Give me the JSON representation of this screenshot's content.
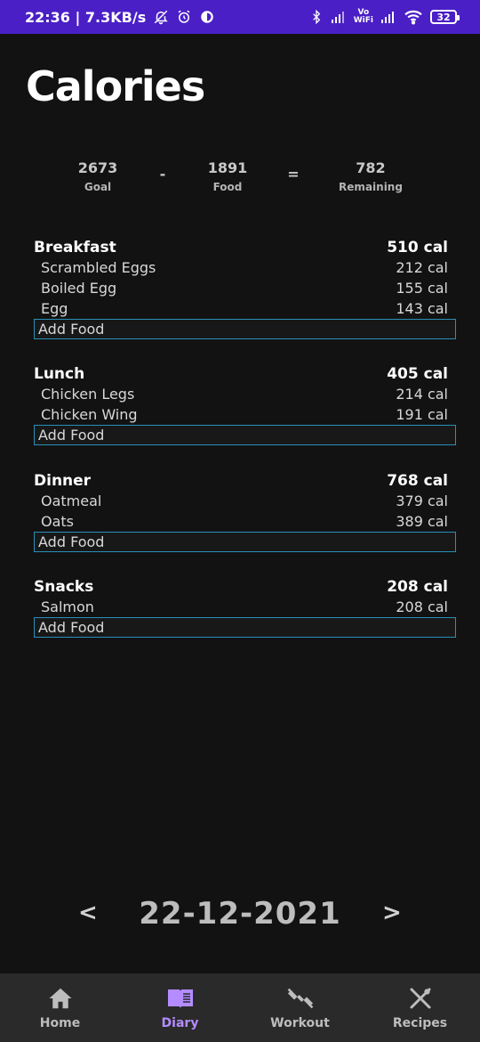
{
  "status_bar": {
    "time_speed": "22:36 | 7.3KB/s",
    "vowifi_top": "Vo",
    "vowifi_bottom": "WiFi",
    "battery": "32"
  },
  "page": {
    "title": "Calories"
  },
  "summary": {
    "goal_value": "2673",
    "goal_label": "Goal",
    "minus": "-",
    "food_value": "1891",
    "food_label": "Food",
    "equals": "=",
    "remaining_value": "782",
    "remaining_label": "Remaining"
  },
  "meals": [
    {
      "name": "Breakfast",
      "total": "510 cal",
      "items": [
        {
          "name": "Scrambled Eggs",
          "cal": "212 cal"
        },
        {
          "name": "Boiled Egg",
          "cal": "155 cal"
        },
        {
          "name": "Egg",
          "cal": "143 cal"
        }
      ],
      "add_label": "Add Food"
    },
    {
      "name": "Lunch",
      "total": "405 cal",
      "items": [
        {
          "name": "Chicken Legs",
          "cal": "214 cal"
        },
        {
          "name": "Chicken Wing",
          "cal": "191 cal"
        }
      ],
      "add_label": "Add Food"
    },
    {
      "name": "Dinner",
      "total": "768 cal",
      "items": [
        {
          "name": "Oatmeal",
          "cal": "379 cal"
        },
        {
          "name": "Oats",
          "cal": "389 cal"
        }
      ],
      "add_label": "Add Food"
    },
    {
      "name": "Snacks",
      "total": "208 cal",
      "items": [
        {
          "name": "Salmon",
          "cal": "208 cal"
        }
      ],
      "add_label": "Add Food"
    }
  ],
  "date_nav": {
    "prev": "<",
    "date": "22-12-2021",
    "next": ">"
  },
  "bottom_nav": [
    {
      "label": "Home",
      "icon": "home-icon",
      "active": false
    },
    {
      "label": "Diary",
      "icon": "diary-icon",
      "active": true
    },
    {
      "label": "Workout",
      "icon": "dumbbell-icon",
      "active": false
    },
    {
      "label": "Recipes",
      "icon": "utensils-icon",
      "active": false
    }
  ],
  "colors": {
    "background": "#121212",
    "status_bar": "#4a1fc6",
    "accent": "#b48cff",
    "add_food_border": "#2a8fb8",
    "nav_background": "#2a2a2a"
  }
}
